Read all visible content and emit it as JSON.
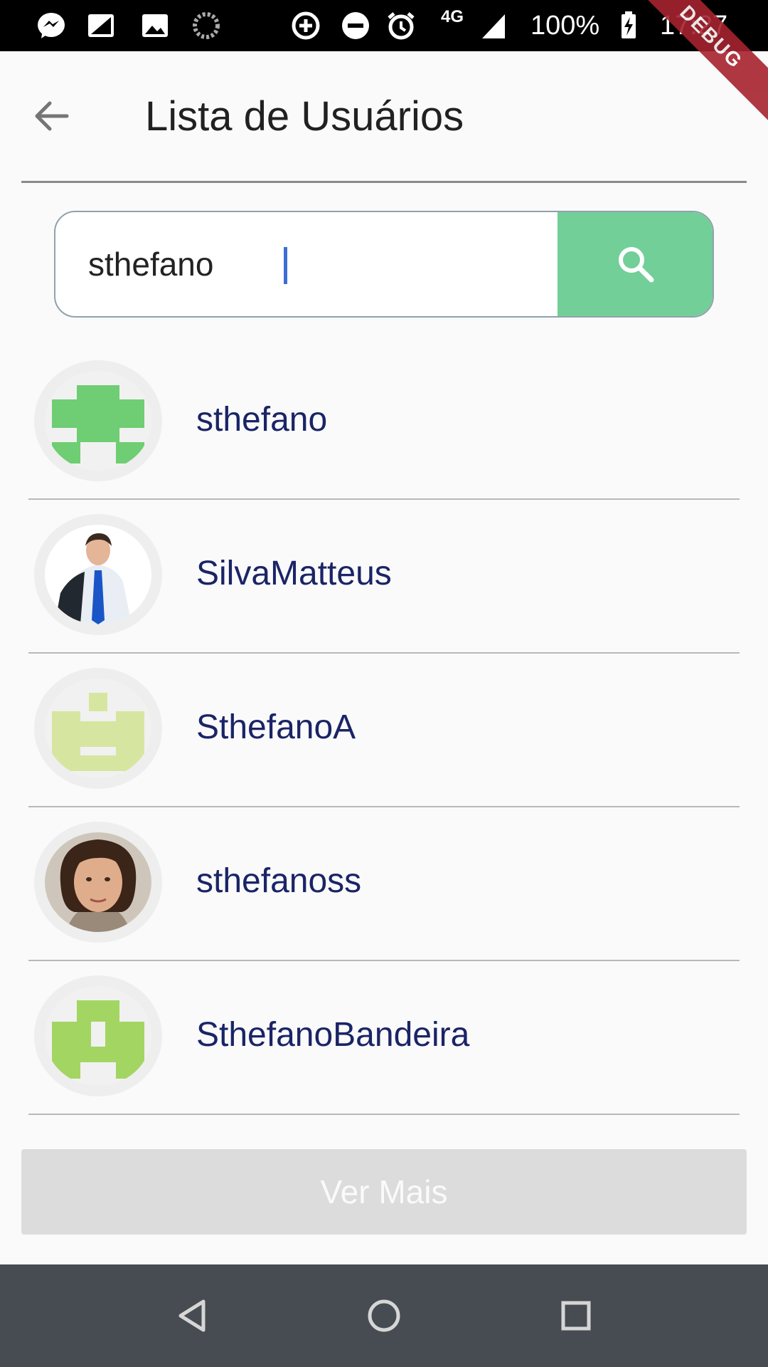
{
  "status_bar": {
    "network": "4G",
    "battery": "100%",
    "time": "17:27",
    "icons": [
      "messenger-icon",
      "sim-icon",
      "gallery-icon",
      "loading-icon",
      "data-saver-icon",
      "dnd-icon",
      "alarm-icon",
      "signal-icon",
      "battery-charging-icon"
    ]
  },
  "debug_banner": "DEBUG",
  "app_bar": {
    "title": "Lista de Usuários",
    "back_icon": "arrow-back-icon"
  },
  "search": {
    "value": "sthefano",
    "button_icon": "search-icon",
    "button_color": "#72cf98"
  },
  "users": [
    {
      "name": "sthefano",
      "avatar": "identicon",
      "avatar_color": "#6fcd73"
    },
    {
      "name": "SilvaMatteus",
      "avatar": "photo-man-suit"
    },
    {
      "name": "SthefanoA",
      "avatar": "identicon",
      "avatar_color": "#d6e6a0"
    },
    {
      "name": "sthefanoss",
      "avatar": "photo-man-portrait"
    },
    {
      "name": "SthefanoBandeira",
      "avatar": "identicon",
      "avatar_color": "#a3d563"
    }
  ],
  "ver_mais_label": "Ver Mais",
  "colors": {
    "title_text": "#212121",
    "user_name_text": "#1a2466",
    "nav_bar": "#474c52"
  },
  "nav_bar": {
    "icons": [
      "back-triangle-icon",
      "home-circle-icon",
      "recents-square-icon"
    ]
  }
}
